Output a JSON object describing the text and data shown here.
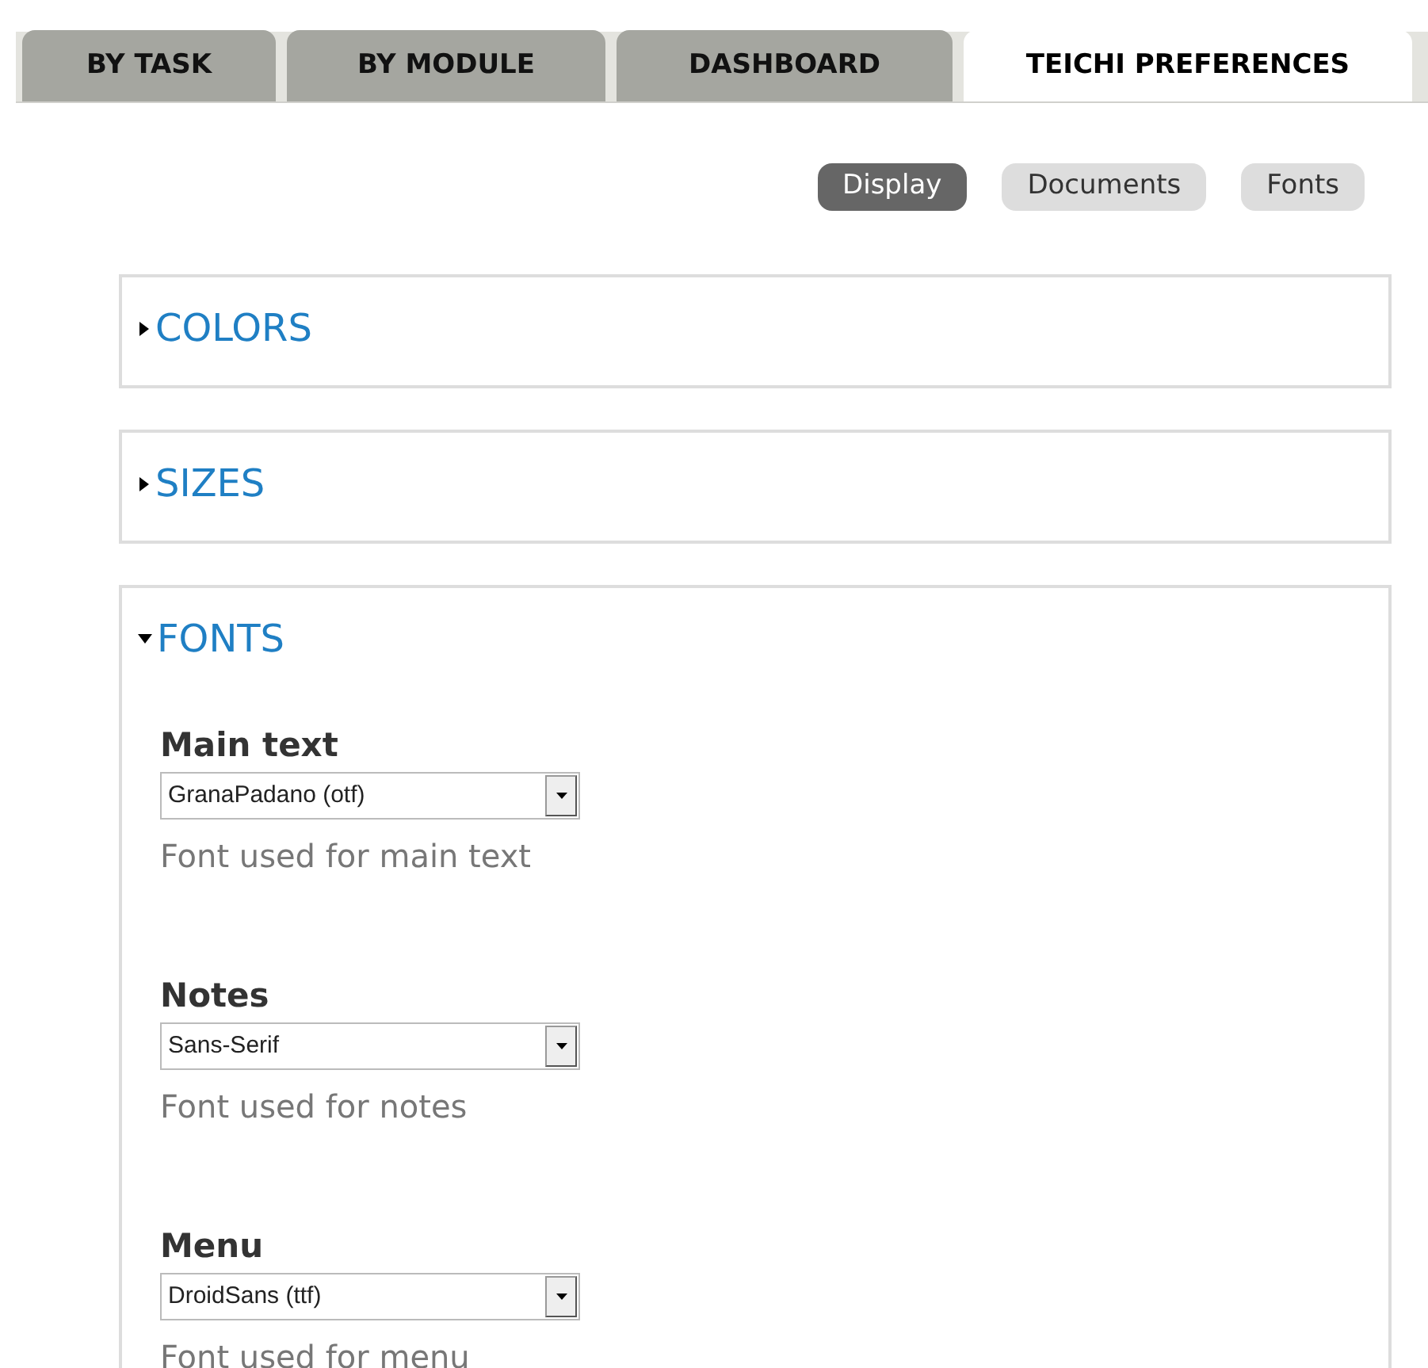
{
  "tabs": [
    {
      "label": "BY TASK",
      "selected": false
    },
    {
      "label": "BY MODULE",
      "selected": false
    },
    {
      "label": "DASHBOARD",
      "selected": false
    },
    {
      "label": "TEICHI PREFERENCES",
      "selected": true
    }
  ],
  "subtabs": [
    {
      "label": "Display",
      "selected": true
    },
    {
      "label": "Documents",
      "selected": false
    },
    {
      "label": "Fonts",
      "selected": false
    }
  ],
  "sections": [
    {
      "title": "COLORS",
      "expanded": false
    },
    {
      "title": "SIZES",
      "expanded": false
    },
    {
      "title": "FONTS",
      "expanded": true,
      "fields": [
        {
          "label": "Main text",
          "value": "GranaPadano (otf)",
          "description": "Font used for main text"
        },
        {
          "label": "Notes",
          "value": "Sans-Serif",
          "description": "Font used for notes"
        },
        {
          "label": "Menu",
          "value": "DroidSans (ttf)",
          "description": "Font used for menu"
        }
      ]
    }
  ]
}
